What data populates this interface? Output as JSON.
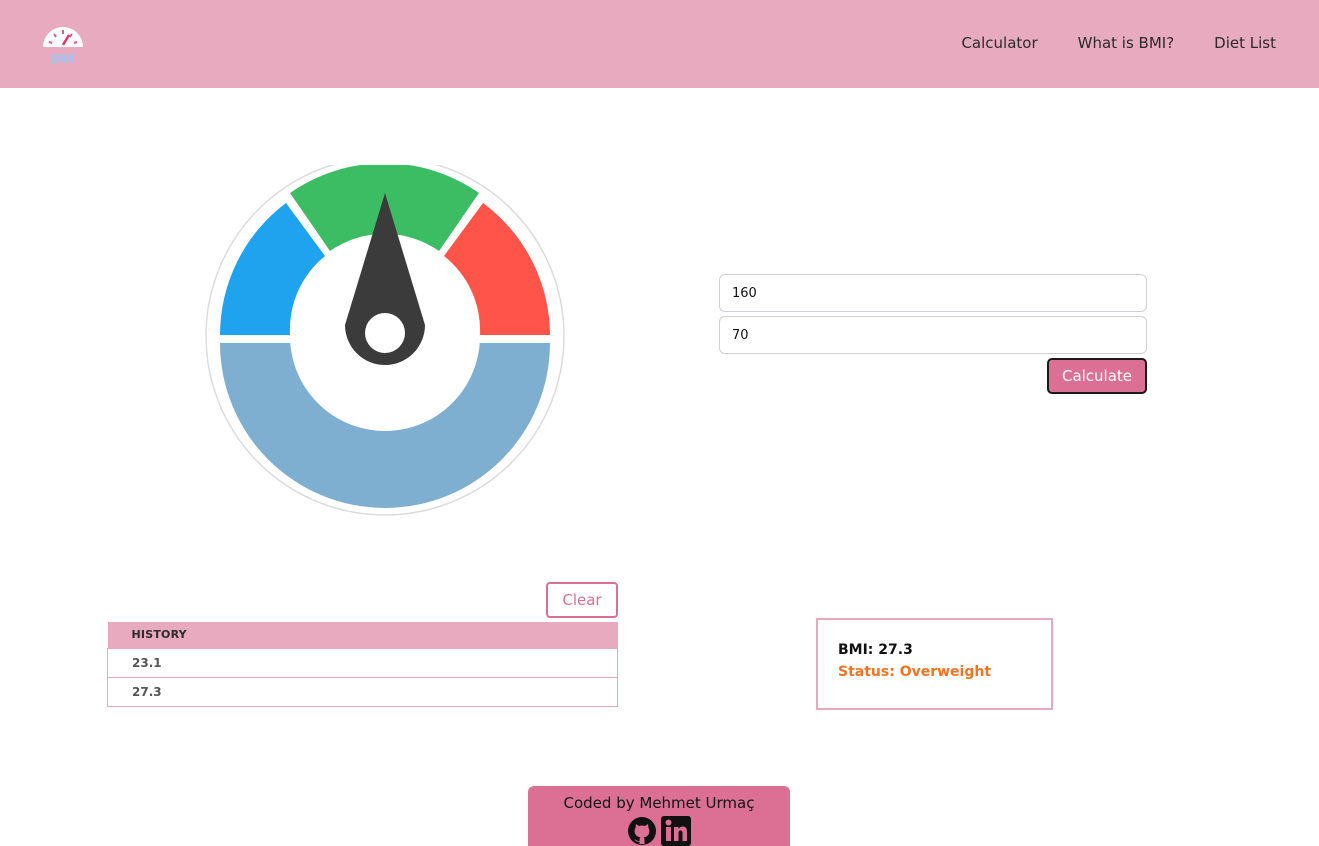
{
  "navbar": {
    "logo": {
      "icon": "bmi-gauge-logo-icon",
      "text": "BMI"
    },
    "links": [
      "Calculator",
      "What is BMI?",
      "Diet List"
    ]
  },
  "gauge": {
    "segments": {
      "underweight_color": "#1fa3ee",
      "normal_color": "#3dbd63",
      "overweight_color": "#fe544a",
      "base_color": "#7fafd0"
    },
    "needle_color": "#3b3b3b"
  },
  "form": {
    "height_value": "160",
    "weight_value": "70",
    "calculate_label": "Calculate"
  },
  "history": {
    "clear_label": "Clear",
    "header": "HISTORY",
    "rows": [
      "23.1",
      "27.3"
    ]
  },
  "result": {
    "bmi_text": "BMI: 27.3",
    "status_text": "Status: Overweight",
    "status_color": "#f07422"
  },
  "footer": {
    "credit": "Coded by Mehmet Urmaç",
    "icons": [
      "github-icon",
      "linkedin-icon"
    ]
  },
  "colors": {
    "navbar": "#e8aabe",
    "accent": "#dc7094"
  }
}
